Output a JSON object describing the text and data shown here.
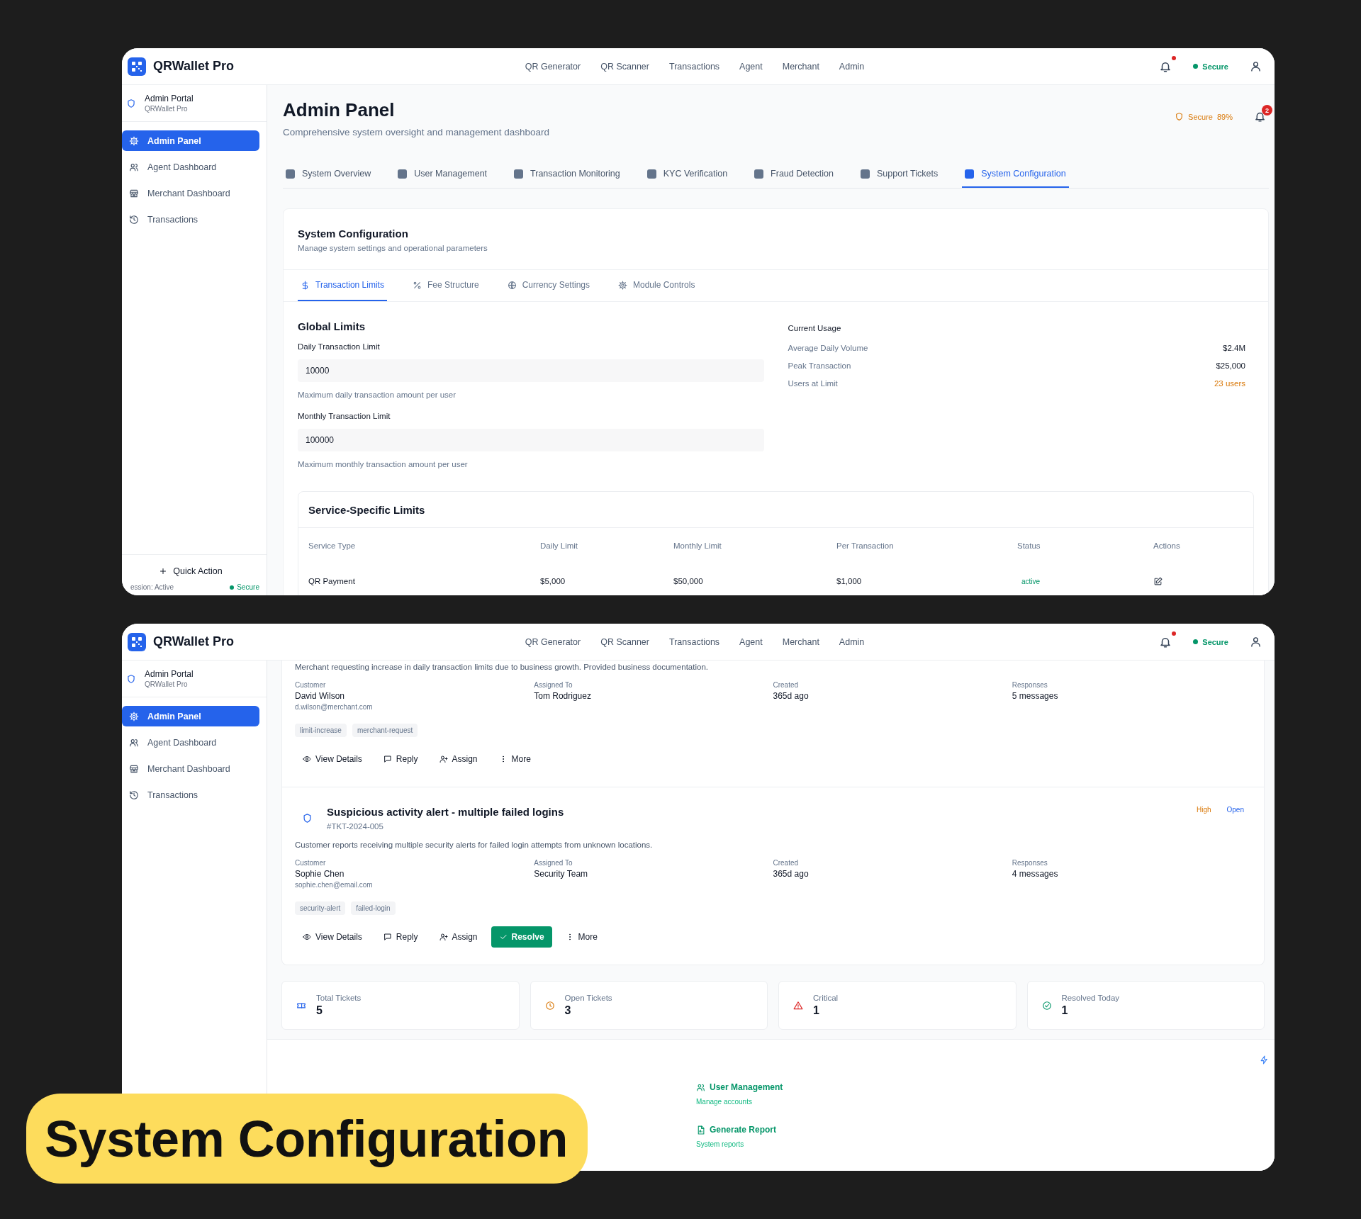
{
  "screens": [
    {
      "kind": "config",
      "header": {
        "brand": "QRWallet Pro",
        "nav": [
          "QR Generator",
          "QR Scanner",
          "Transactions",
          "Agent",
          "Merchant",
          "Admin"
        ],
        "notification": true,
        "status": "Secure"
      },
      "sidebar": {
        "title": "Admin Portal",
        "subtitle": "QRWallet Pro",
        "items": [
          {
            "label": "Admin Panel",
            "kind": "settings",
            "selected": true
          },
          {
            "label": "Agent Dashboard",
            "kind": "agents",
            "selected": false
          },
          {
            "label": "Merchant Dashboard",
            "kind": "store",
            "selected": false
          },
          {
            "label": "Transactions",
            "kind": "history",
            "selected": false
          }
        ],
        "quick_action": "Quick Action",
        "session": "ession: Active",
        "session_status": "Secure"
      },
      "page": {
        "title": "Admin Panel",
        "subtitle": "Comprehensive system oversight and management dashboard",
        "security_label": "Secure",
        "security_score": "89%",
        "alerts": "2"
      },
      "tabs": [
        {
          "label": "System Overview",
          "selected": false
        },
        {
          "label": "User Management",
          "selected": false
        },
        {
          "label": "Transaction Monitoring",
          "selected": false
        },
        {
          "label": "KYC Verification",
          "selected": false
        },
        {
          "label": "Fraud Detection",
          "selected": false
        },
        {
          "label": "Support Tickets",
          "selected": false
        },
        {
          "label": "System Configuration",
          "selected": true
        }
      ],
      "config": {
        "title": "System Configuration",
        "subtitle": "Manage system settings and operational parameters",
        "subtabs": [
          {
            "label": "Transaction Limits",
            "kind": "dollar",
            "selected": true
          },
          {
            "label": "Fee Structure",
            "kind": "percent",
            "selected": false
          },
          {
            "label": "Currency Settings",
            "kind": "globe",
            "selected": false
          },
          {
            "label": "Module Controls",
            "kind": "gear",
            "selected": false
          }
        ],
        "global_limits": {
          "title": "Global Limits",
          "fields": [
            {
              "label": "Daily Transaction Limit",
              "value": "10000",
              "help": "Maximum daily transaction amount per user"
            },
            {
              "label": "Monthly Transaction Limit",
              "value": "100000",
              "help": "Maximum monthly transaction amount per user"
            }
          ]
        },
        "usage": {
          "title": "Current Usage",
          "rows": [
            {
              "label": "Average Daily Volume",
              "value": "$2.4M",
              "highlight": false
            },
            {
              "label": "Peak Transaction",
              "value": "$25,000",
              "highlight": false
            },
            {
              "label": "Users at Limit",
              "value": "23 users",
              "highlight": true
            }
          ]
        },
        "service_limits": {
          "title": "Service-Specific Limits",
          "columns": [
            "Service Type",
            "Daily Limit",
            "Monthly Limit",
            "Per Transaction",
            "Status",
            "Actions"
          ],
          "rows": [
            {
              "service": "QR Payment",
              "daily": "$5,000",
              "monthly": "$50,000",
              "per_transaction": "$1,000",
              "status": "active"
            }
          ]
        }
      }
    },
    {
      "kind": "tickets",
      "header": {
        "brand": "QRWallet Pro",
        "nav": [
          "QR Generator",
          "QR Scanner",
          "Transactions",
          "Agent",
          "Merchant",
          "Admin"
        ],
        "notification": true,
        "status": "Secure"
      },
      "sidebar": {
        "title": "Admin Portal",
        "subtitle": "QRWallet Pro",
        "items": [
          {
            "label": "Admin Panel",
            "kind": "settings",
            "selected": true
          },
          {
            "label": "Agent Dashboard",
            "kind": "agents",
            "selected": false
          },
          {
            "label": "Merchant Dashboard",
            "kind": "store",
            "selected": false
          },
          {
            "label": "Transactions",
            "kind": "history",
            "selected": false
          }
        ]
      },
      "tickets": [
        {
          "description": "Merchant requesting increase in daily transaction limits due to business growth. Provided business documentation.",
          "meta": [
            {
              "label": "Customer",
              "value": "David Wilson",
              "detail": "d.wilson@merchant.com"
            },
            {
              "label": "Assigned To",
              "value": "Tom Rodriguez"
            },
            {
              "label": "Created",
              "value": "365d ago"
            },
            {
              "label": "Responses",
              "value": "5 messages"
            }
          ],
          "tags": [
            "limit-increase",
            "merchant-request"
          ],
          "actions": [
            {
              "label": "View Details",
              "kind": "view"
            },
            {
              "label": "Reply",
              "kind": "reply"
            },
            {
              "label": "Assign",
              "kind": "assign"
            },
            {
              "label": "More",
              "kind": "more"
            }
          ]
        },
        {
          "title": "Suspicious activity alert - multiple failed logins",
          "id": "#TKT-2024-005",
          "priority": "High",
          "status": "Open",
          "description": "Customer reports receiving multiple security alerts for failed login attempts from unknown locations.",
          "meta": [
            {
              "label": "Customer",
              "value": "Sophie Chen",
              "detail": "sophie.chen@email.com"
            },
            {
              "label": "Assigned To",
              "value": "Security Team"
            },
            {
              "label": "Created",
              "value": "365d ago"
            },
            {
              "label": "Responses",
              "value": "4 messages"
            }
          ],
          "tags": [
            "security-alert",
            "failed-login"
          ],
          "actions": [
            {
              "label": "View Details",
              "kind": "view"
            },
            {
              "label": "Reply",
              "kind": "reply"
            },
            {
              "label": "Assign",
              "kind": "assign"
            },
            {
              "label": "Resolve",
              "kind": "resolve"
            },
            {
              "label": "More",
              "kind": "more"
            }
          ]
        }
      ],
      "stats": [
        {
          "label": "Total Tickets",
          "value": "5",
          "kind": "total"
        },
        {
          "label": "Open Tickets",
          "value": "3",
          "kind": "open"
        },
        {
          "label": "Critical",
          "value": "1",
          "kind": "critical"
        },
        {
          "label": "Resolved Today",
          "value": "1",
          "kind": "resolved"
        }
      ],
      "quick_links": [
        {
          "label": "User Management",
          "description": "Manage accounts",
          "kind": "users"
        },
        {
          "label": "Generate Report",
          "description": "System reports",
          "kind": "report"
        }
      ]
    }
  ],
  "banner": {
    "label": "System Configuration"
  }
}
